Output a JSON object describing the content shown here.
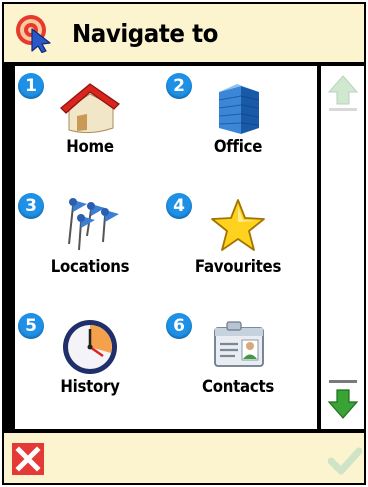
{
  "header": {
    "title": "Navigate to",
    "icon": "navigation-target-icon"
  },
  "menu": {
    "items": [
      {
        "number": "1",
        "label": "Home",
        "icon": "house-icon"
      },
      {
        "number": "2",
        "label": "Office",
        "icon": "office-building-icon"
      },
      {
        "number": "3",
        "label": "Locations",
        "icon": "location-pins-icon"
      },
      {
        "number": "4",
        "label": "Favourites",
        "icon": "star-icon"
      },
      {
        "number": "5",
        "label": "History",
        "icon": "clock-icon"
      },
      {
        "number": "6",
        "label": "Contacts",
        "icon": "contact-card-icon"
      }
    ]
  },
  "scroll": {
    "up_icon": "arrow-up-icon",
    "down_icon": "arrow-down-icon"
  },
  "footer": {
    "cancel_icon": "close-icon",
    "confirm_icon": "checkmark-icon"
  },
  "colors": {
    "header_bg": "#fcf3cf",
    "badge": "#1e90e6",
    "cancel": "#e53935",
    "scroll_down": "#3aa335"
  }
}
